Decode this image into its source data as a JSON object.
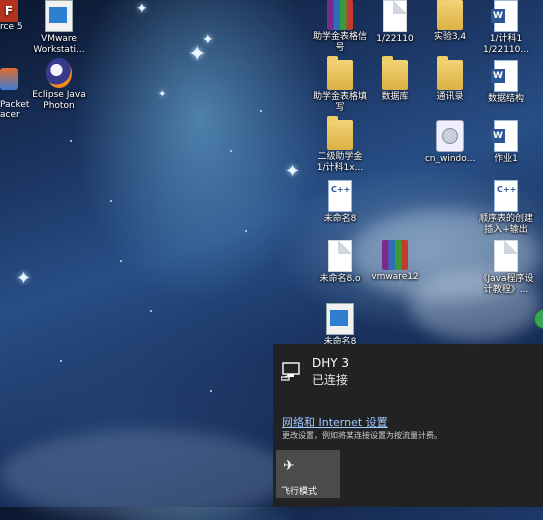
{
  "desktop": {
    "left_partial_labels": [
      "rce 5",
      "Packet\nacer"
    ],
    "icons": [
      {
        "name": "vmware-workstation-icon",
        "label": "VMware\nWorkstati...",
        "type": "app"
      },
      {
        "name": "eclipse-java-photon-icon",
        "label": "Eclipse Java\nPhoton",
        "type": "app"
      },
      {
        "name": "rar-icon",
        "label": "助学金表格信\n号",
        "type": "rar"
      },
      {
        "name": "file-1722110-icon",
        "label": "1/22110",
        "type": "page"
      },
      {
        "name": "folder-shiyan34-icon",
        "label": "实验3,4",
        "type": "folder"
      },
      {
        "name": "file-1722110-word-icon",
        "label": "1/计科1\n1/22110...",
        "type": "word"
      },
      {
        "name": "folder-zhuxuejin-icon",
        "label": "助学金表格填\n写",
        "type": "folder"
      },
      {
        "name": "folder-shujuku-icon",
        "label": "数据库",
        "type": "folder"
      },
      {
        "name": "folder-tongxunlu-icon",
        "label": "通讯录",
        "type": "folder"
      },
      {
        "name": "file-shujujiegou-icon",
        "label": "数据结构",
        "type": "word"
      },
      {
        "name": "folder-erjishizi-icon",
        "label": "二级助学金\n1/计科1x...",
        "type": "folder"
      },
      {
        "name": "cn-windows-icon",
        "label": "cn_windo...",
        "type": "disc"
      },
      {
        "name": "file-zuoye1-icon",
        "label": "作业1",
        "type": "word"
      },
      {
        "name": "cpp-weiming8-icon",
        "label": "未命名8",
        "type": "cpp"
      },
      {
        "name": "cpp-shunxubiao-icon",
        "label": "顺序表的创建\n插入+输出",
        "type": "cpp"
      },
      {
        "name": "file-weiming8-0-icon",
        "label": "未命名8.o",
        "type": "page"
      },
      {
        "name": "rar-vmware12-icon",
        "label": "vmware12",
        "type": "rar"
      },
      {
        "name": "file-java-icon",
        "label": "《Java程序设\n计教程》...",
        "type": "page"
      },
      {
        "name": "exe-weiming8-icon",
        "label": "未命名8",
        "type": "app"
      }
    ]
  },
  "network_flyout": {
    "network_name": "DHY 3",
    "network_status": "已连接",
    "settings_link": "网络和 Internet 设置",
    "settings_desc": "更改设置，例如将某连接设置为按流量计费。",
    "airplane_label": "飞行模式"
  },
  "colors": {
    "flyout_bg": "#222222",
    "link": "#9fc8ff",
    "tile": "#4b4b4b"
  }
}
